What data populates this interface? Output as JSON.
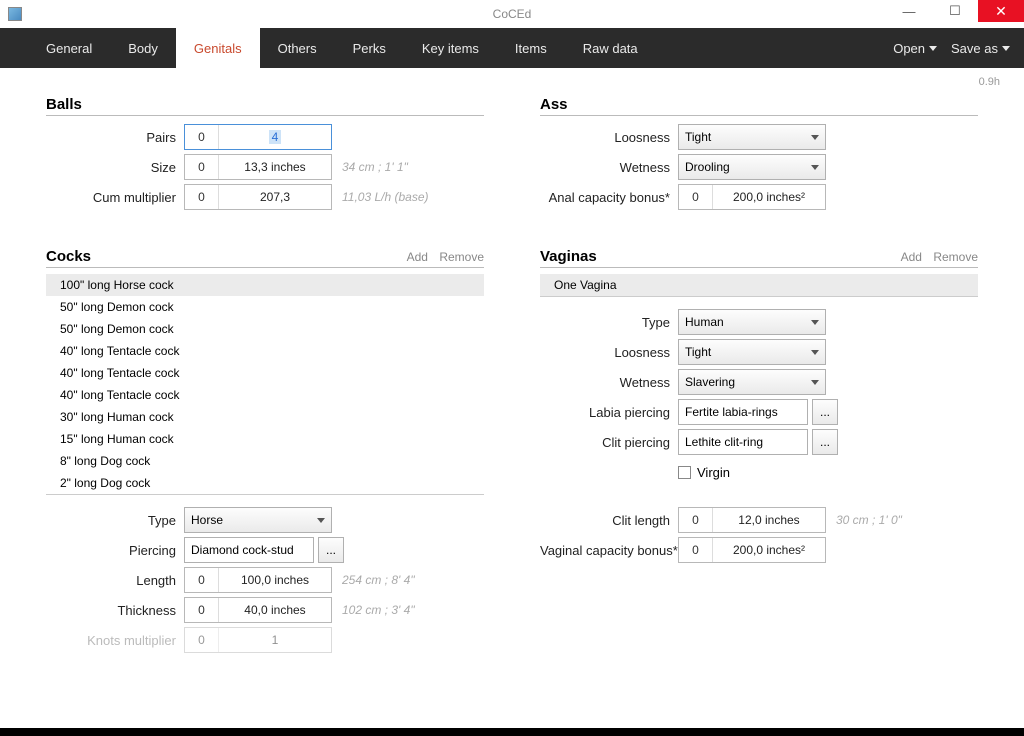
{
  "window": {
    "title": "CoCEd",
    "version": "0.9h"
  },
  "menubar": {
    "tabs": [
      "General",
      "Body",
      "Genitals",
      "Others",
      "Perks",
      "Key items",
      "Items",
      "Raw data"
    ],
    "active": 2,
    "open": "Open",
    "saveas": "Save as"
  },
  "balls": {
    "header": "Balls",
    "pairs_label": "Pairs",
    "pairs_z": "0",
    "pairs_v": "4",
    "size_label": "Size",
    "size_z": "0",
    "size_v": "13,3 inches",
    "size_hint": "34 cm ; 1' 1\"",
    "cum_label": "Cum multiplier",
    "cum_z": "0",
    "cum_v": "207,3",
    "cum_hint": "11,03 L/h (base)"
  },
  "cocks": {
    "header": "Cocks",
    "add": "Add",
    "remove": "Remove",
    "items": [
      "100\" long Horse cock",
      "50\" long Demon cock",
      "50\" long Demon cock",
      "40\" long Tentacle cock",
      "40\" long Tentacle cock",
      "40\" long Tentacle cock",
      "30\" long Human cock",
      "15\" long Human cock",
      "8\" long Dog cock",
      "2\" long Dog cock"
    ],
    "type_label": "Type",
    "type_val": "Horse",
    "piercing_label": "Piercing",
    "piercing_val": "Diamond cock-stud",
    "ellipsis": "...",
    "length_label": "Length",
    "length_z": "0",
    "length_v": "100,0 inches",
    "length_hint": "254 cm ; 8' 4\"",
    "thick_label": "Thickness",
    "thick_z": "0",
    "thick_v": "40,0 inches",
    "thick_hint": "102 cm ; 3' 4\"",
    "knots_label": "Knots multiplier",
    "knots_z": "0",
    "knots_v": "1"
  },
  "ass": {
    "header": "Ass",
    "loos_label": "Loosness",
    "loos_val": "Tight",
    "wet_label": "Wetness",
    "wet_val": "Drooling",
    "cap_label": "Anal capacity bonus*",
    "cap_z": "0",
    "cap_v": "200,0 inches²"
  },
  "vaginas": {
    "header": "Vaginas",
    "add": "Add",
    "remove": "Remove",
    "items": [
      "One Vagina"
    ],
    "type_label": "Type",
    "type_val": "Human",
    "loos_label": "Loosness",
    "loos_val": "Tight",
    "wet_label": "Wetness",
    "wet_val": "Slavering",
    "labia_label": "Labia piercing",
    "labia_val": "Fertite labia-rings",
    "clit_label": "Clit piercing",
    "clit_val": "Lethite clit-ring",
    "virgin_label": "Virgin",
    "clitlen_label": "Clit length",
    "clitlen_z": "0",
    "clitlen_v": "12,0 inches",
    "clitlen_hint": "30 cm ; 1' 0\"",
    "cap_label": "Vaginal capacity bonus*",
    "cap_z": "0",
    "cap_v": "200,0 inches²",
    "ellipsis": "..."
  }
}
